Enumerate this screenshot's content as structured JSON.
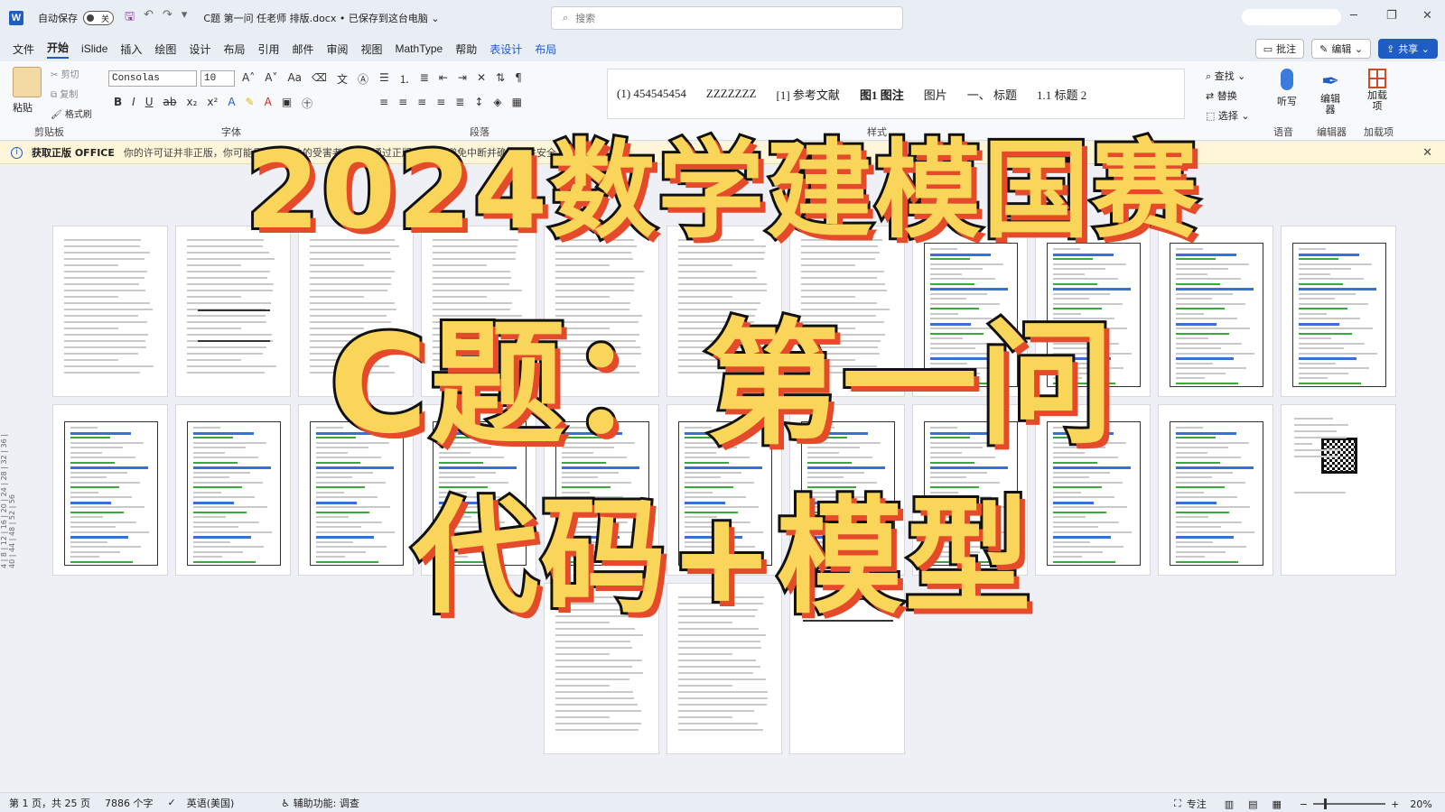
{
  "titlebar": {
    "app_logo": "W",
    "autosave_label": "自动保存",
    "autosave_state": "关",
    "doc_title": "C题 第一问 任老师 排版.docx • 已保存到这台电脑 ⌄",
    "search_placeholder": "搜索",
    "minimize": "─",
    "restore": "❐",
    "close": "✕"
  },
  "menu": {
    "tabs": [
      "文件",
      "开始",
      "iSlide",
      "插入",
      "绘图",
      "设计",
      "布局",
      "引用",
      "邮件",
      "审阅",
      "视图",
      "MathType",
      "帮助",
      "表设计",
      "布局"
    ],
    "comment_button": "批注",
    "edit_button": "编辑 ⌄",
    "share_button": "共享 ⌄"
  },
  "ribbon": {
    "clipboard": {
      "paste": "粘贴",
      "cut": "剪切",
      "copy": "复制",
      "format_painter": "格式刷",
      "group_label": "剪贴板"
    },
    "font": {
      "name": "Consolas",
      "size": "10",
      "group_label": "字体"
    },
    "paragraph_label": "段落",
    "styles_label": "样式",
    "styles": [
      "(1)  454545454",
      "ZZZZZZZ",
      "[1]  参考文献",
      "图1  图注",
      "图片",
      "一、 标题",
      "1.1  标题 2"
    ],
    "editing": {
      "find": "查找 ⌄",
      "replace": "替换",
      "select": "选择 ⌄"
    },
    "voice": {
      "label": "听写",
      "group": "语音"
    },
    "editor": {
      "label": "编辑器",
      "group": "编辑器"
    },
    "addins": {
      "label": "加载项",
      "group": "加载项"
    }
  },
  "infobar": {
    "icon": "i",
    "heading": "获取正版 OFFICE",
    "message": "你的许可证并非正版，你可能是盗版软件的受害者。立即通过正版 Office 避免中断并确保文件安全。",
    "close": "✕"
  },
  "ruler": {
    "vertical_ticks": "4 | 8 | 12 | 16 | 20 | 24 | 28 | 32 | 36 | 40 | 44 | 48 | 52 | 56"
  },
  "overlay": {
    "line1": "2024数学建模国赛",
    "line2": "C题：第一问",
    "line3": "代码+模型"
  },
  "statusbar": {
    "page": "第 1 页，共 25 页",
    "words": "7886 个字",
    "language": "英语(美国)",
    "accessibility": "辅助功能: 调查",
    "focus": "专注",
    "zoom": "20%"
  }
}
